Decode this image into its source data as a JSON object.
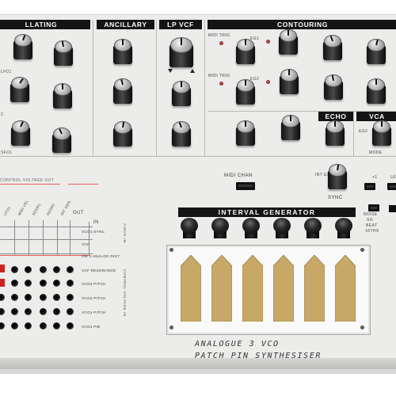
{
  "sections": {
    "oscillating": "LLATING",
    "ancillary": "ANCILLARY",
    "lp_vcf": "LP VCF",
    "contouring": "CONTOURING",
    "echo": "ECHO",
    "vca": "VCA",
    "interval_generator": "INTERVAL GENERATOR"
  },
  "labels": {
    "midi_chan": "MIDI CHAN",
    "sync": "SYNC",
    "int_ext": "INT EXT",
    "plus_one": "+1",
    "le": "LE",
    "noise": "NOISE",
    "beat": "BEAT",
    "sixteenths": "16THS",
    "so": "SO",
    "mode": "MODE",
    "midi_trig_1": "MIDI TRIG",
    "midi_trig_2": "MIDI TRIG",
    "eg1": "EG1",
    "eg2": "EG2",
    "eg_vca": "EG2",
    "lfo1": "LFO1",
    "lfo2": "2",
    "sfo1": "SFO1",
    "control_voltage_out": "CONTROL VOLTAGE OUT",
    "audio_in": "AUDIO IN",
    "control_voltage_in": "CONTROL VOLTAGE IN",
    "out": "OUT",
    "in": "IN"
  },
  "matrix": {
    "columns": [
      "LFO1",
      "MIDI VEL",
      "ADSR1",
      "ADSR2",
      "INT GEN"
    ],
    "rows": [
      "VCO1 SYNC",
      "VCF",
      "SW 1 ANALOG DIST",
      "VCF RESONANCE",
      "VCO3 PITCH",
      "VCO2 PITCH",
      "VCO1 PITCH",
      "VCO1 PW"
    ],
    "audio_rows": [
      "VCO1 SYNC",
      "VCF",
      "SW 1 ANALOG DIST"
    ]
  },
  "title": {
    "line1": "ANALOGUE 3 VCO",
    "line2": "PATCH PIN SYNTHESISER"
  }
}
